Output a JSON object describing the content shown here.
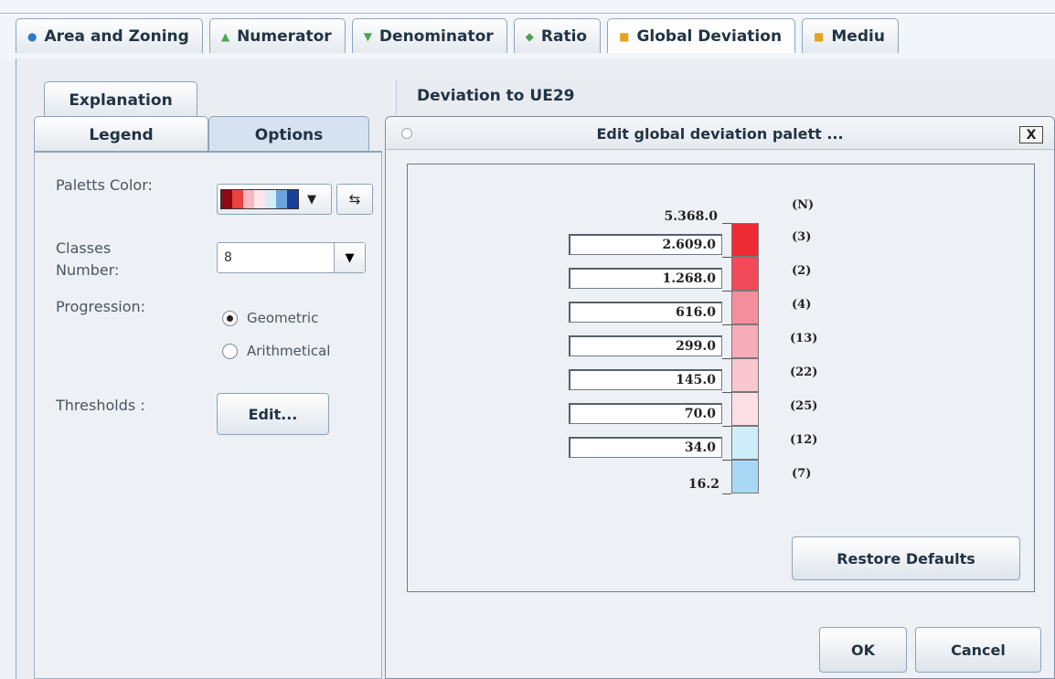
{
  "top_tabs": [
    {
      "label": "Area and Zoning",
      "icon": "circle-dot-icon"
    },
    {
      "label": "Numerator",
      "icon": "triangle-up-icon"
    },
    {
      "label": "Denominator",
      "icon": "triangle-down-icon"
    },
    {
      "label": "Ratio",
      "icon": "diamond-icon"
    },
    {
      "label": "Global Deviation",
      "icon": "square-icon",
      "active": true
    },
    {
      "label": "Mediu",
      "icon": "square-icon"
    }
  ],
  "left_panel": {
    "tabs": {
      "explanation": "Explanation",
      "legend": "Legend",
      "options": "Options"
    },
    "palette_label": "Paletts Color:",
    "palette_colors": [
      "#8b0a12",
      "#e8433f",
      "#f6b7c0",
      "#fde6ea",
      "#d5ebf7",
      "#6aa6dd",
      "#1a3f9a"
    ],
    "classes_label_1": "Classes",
    "classes_label_2": "Number:",
    "classes_value": "8",
    "progression_label": "Progression:",
    "progression_options": [
      "Geometric",
      "Arithmetical"
    ],
    "progression_selected": "Geometric",
    "thresholds_label": "Thresholds :",
    "edit_button": "Edit..."
  },
  "deviation_title": "Deviation to UE29",
  "dialog": {
    "title": "Edit global deviation palett ...",
    "close_label": "X",
    "top_value": "5.368.0",
    "bottom_value": "16.2",
    "count_header": "(N)",
    "thresholds": [
      "2.609.0",
      "1.268.0",
      "616.0",
      "299.0",
      "145.0",
      "70.0",
      "34.0"
    ],
    "classes": [
      {
        "color": "#ee2a33",
        "count": "(3)"
      },
      {
        "color": "#f24a58",
        "count": "(2)"
      },
      {
        "color": "#f58e9c",
        "count": "(4)"
      },
      {
        "color": "#f7adb8",
        "count": "(13)"
      },
      {
        "color": "#fac7d0",
        "count": "(22)"
      },
      {
        "color": "#fde0e6",
        "count": "(25)"
      },
      {
        "color": "#cfeefb",
        "count": "(12)"
      },
      {
        "color": "#a8d8f6",
        "count": "(7)"
      }
    ],
    "restore_button": "Restore Defaults",
    "ok_button": "OK",
    "cancel_button": "Cancel"
  }
}
